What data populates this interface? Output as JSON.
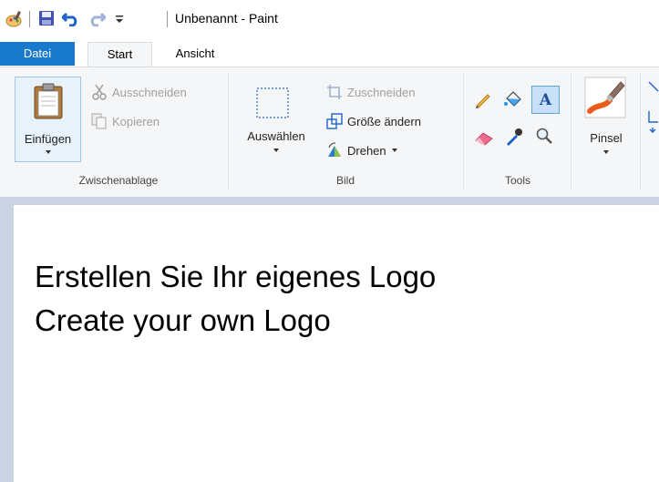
{
  "window": {
    "title": "Unbenannt - Paint",
    "quick_access": {
      "app_icon": "paint-app-icon",
      "save_icon": "save-icon",
      "undo_icon": "undo-icon",
      "redo_icon": "redo-icon",
      "customize_icon": "customize-quick-access-icon"
    }
  },
  "tabs": [
    {
      "label": "Datei",
      "active": false
    },
    {
      "label": "Start",
      "active": true
    },
    {
      "label": "Ansicht",
      "active": false
    }
  ],
  "ribbon": {
    "clipboard": {
      "group_label": "Zwischenablage",
      "paste_label": "Einfügen",
      "cut_label": "Ausschneiden",
      "copy_label": "Kopieren"
    },
    "image": {
      "group_label": "Bild",
      "select_label": "Auswählen",
      "crop_label": "Zuschneiden",
      "resize_label": "Größe ändern",
      "rotate_label": "Drehen"
    },
    "tools": {
      "group_label": "Tools",
      "items": [
        "pencil-icon",
        "fill-icon",
        "text-icon",
        "eraser-icon",
        "color-picker-icon",
        "magnifier-icon"
      ],
      "text_tool_glyph": "A"
    },
    "brushes": {
      "label": "Pinsel"
    }
  },
  "canvas": {
    "lines": [
      "Erstellen Sie Ihr eigenes Logo",
      "Create your own Logo"
    ]
  },
  "colors": {
    "file_tab": "#1979ca",
    "ribbon_bg": "#f5f6f7",
    "workspace_bg": "#c9d3e2"
  }
}
